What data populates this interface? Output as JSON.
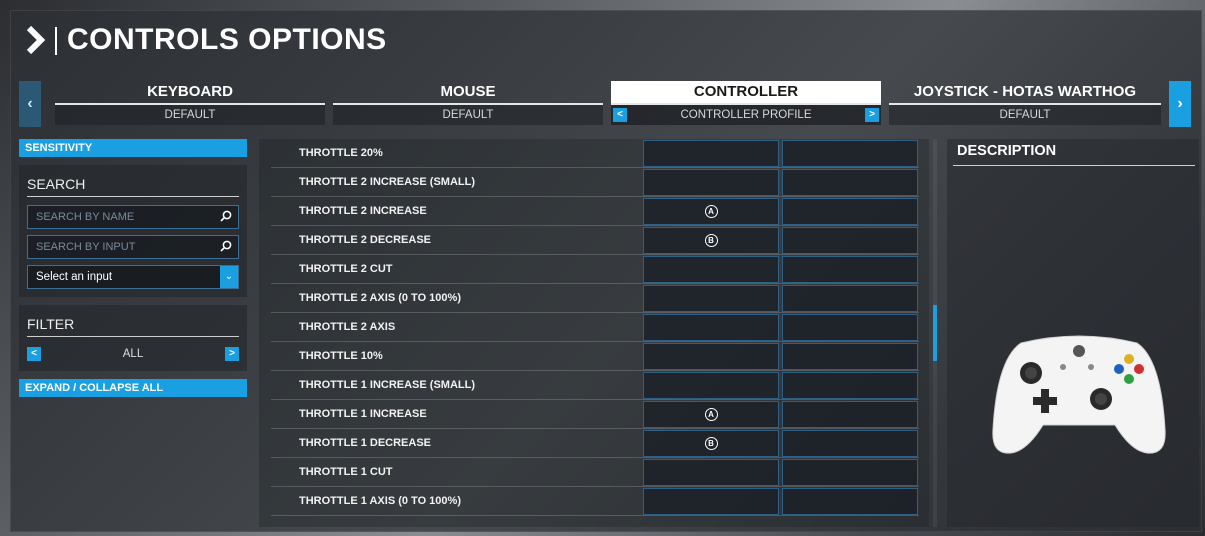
{
  "header": {
    "title": "CONTROLS OPTIONS"
  },
  "tabs": [
    {
      "label": "KEYBOARD",
      "sub": "DEFAULT"
    },
    {
      "label": "MOUSE",
      "sub": "DEFAULT"
    },
    {
      "label": "CONTROLLER",
      "sub": "CONTROLLER PROFILE"
    },
    {
      "label": "JOYSTICK - HOTAS WARTHOG",
      "sub": "DEFAULT"
    }
  ],
  "left": {
    "sensitivity_label": "SENSITIVITY",
    "search_title": "SEARCH",
    "search_by_name_placeholder": "SEARCH BY NAME",
    "search_by_input_placeholder": "SEARCH BY INPUT",
    "select_input": "Select an input",
    "filter_title": "FILTER",
    "filter_value": "ALL",
    "expand_collapse": "EXPAND / COLLAPSE ALL"
  },
  "rows": [
    {
      "label": "THROTTLE 20%",
      "input1": "",
      "input2": ""
    },
    {
      "label": "THROTTLE 2 INCREASE (SMALL)",
      "input1": "",
      "input2": ""
    },
    {
      "label": "THROTTLE 2 INCREASE",
      "input1": "A",
      "input2": ""
    },
    {
      "label": "THROTTLE 2 DECREASE",
      "input1": "B",
      "input2": ""
    },
    {
      "label": "THROTTLE 2 CUT",
      "input1": "",
      "input2": ""
    },
    {
      "label": "THROTTLE 2 AXIS (0 TO 100%)",
      "input1": "",
      "input2": ""
    },
    {
      "label": "THROTTLE 2 AXIS",
      "input1": "",
      "input2": ""
    },
    {
      "label": "THROTTLE 10%",
      "input1": "",
      "input2": ""
    },
    {
      "label": "THROTTLE 1 INCREASE (SMALL)",
      "input1": "",
      "input2": ""
    },
    {
      "label": "THROTTLE 1 INCREASE",
      "input1": "A",
      "input2": ""
    },
    {
      "label": "THROTTLE 1 DECREASE",
      "input1": "B",
      "input2": ""
    },
    {
      "label": "THROTTLE 1 CUT",
      "input1": "",
      "input2": ""
    },
    {
      "label": "THROTTLE 1 AXIS (0 TO 100%)",
      "input1": "",
      "input2": ""
    }
  ],
  "description": {
    "title": "DESCRIPTION"
  },
  "colors": {
    "accent": "#1a9fe0",
    "panel": "#2d3035"
  },
  "icons": [
    "chevron-right-icon",
    "search-icon",
    "chevron-down-icon",
    "chevron-left-icon",
    "xbox-controller-icon"
  ]
}
